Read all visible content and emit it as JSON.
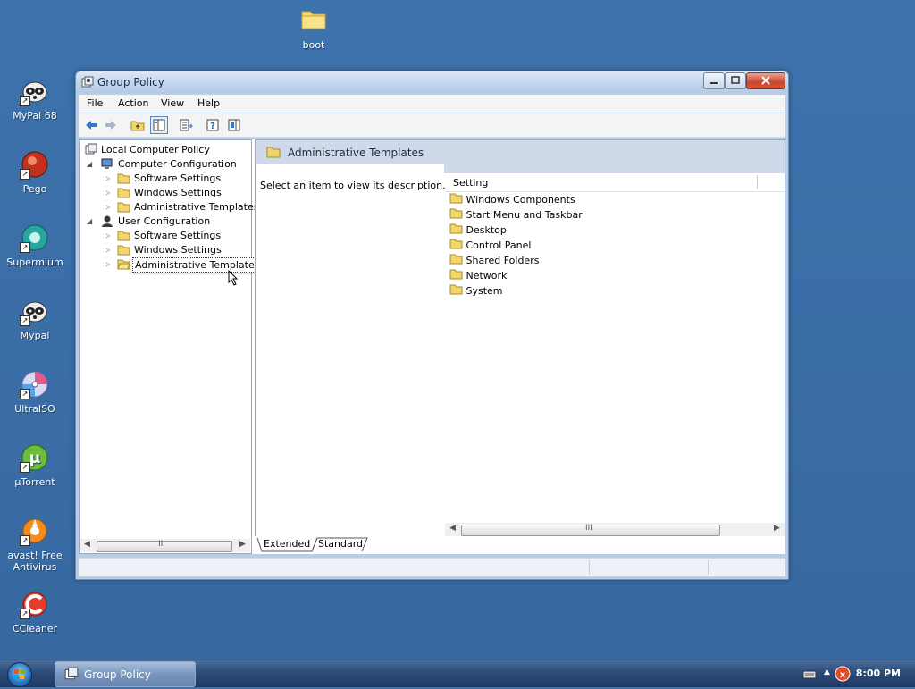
{
  "desktop": {
    "top_icon": "boot",
    "icons": [
      "MyPal 68",
      "Pego",
      "Supermium",
      "Mypal",
      "UltraISO",
      "µTorrent",
      "avast! Free Antivirus",
      "CCleaner"
    ]
  },
  "window": {
    "title": "Group Policy",
    "menu": [
      "File",
      "Action",
      "View",
      "Help"
    ],
    "tree": {
      "root": "Local Computer Policy",
      "computer": "Computer Configuration",
      "computer_children": [
        "Software Settings",
        "Windows Settings",
        "Administrative Templates"
      ],
      "user": "User Configuration",
      "user_children": [
        "Software Settings",
        "Windows Settings",
        "Administrative Templates"
      ]
    },
    "right": {
      "header": "Administrative Templates",
      "description": "Select an item to view its description.",
      "column": "Setting",
      "items": [
        "Windows Components",
        "Start Menu and Taskbar",
        "Desktop",
        "Control Panel",
        "Shared Folders",
        "Network",
        "System"
      ]
    },
    "tabs": [
      "Extended",
      "Standard"
    ],
    "scroll_grip": "III"
  },
  "taskbar": {
    "task": "Group Policy",
    "clock": "8:00 PM"
  },
  "colors": {
    "desktop": "#3a6ea5",
    "folder": "#f2d56b",
    "header_band": "#cfd9ea"
  }
}
